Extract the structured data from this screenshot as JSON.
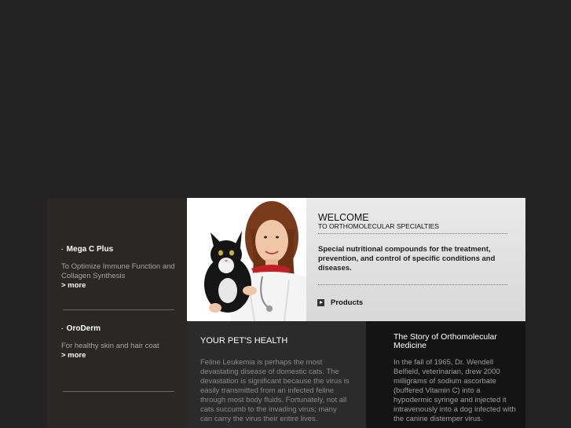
{
  "sidebar": {
    "items": [
      {
        "title": "Mega C Plus",
        "description": "To Optimize Immune Function and Collagen Synthesis",
        "more": "> more"
      },
      {
        "title": "OroDerm",
        "description": "For healthy skin and hair coat",
        "more": "> more"
      }
    ]
  },
  "hero": {
    "welcome": "WELCOME",
    "subtitle": "TO ORTHOMOLECULAR SPECIALTIES",
    "description": "Special nutritional compounds for the treatment, prevention, and control of specific conditions and diseases.",
    "products_label": "Products"
  },
  "health": {
    "title": "YOUR PET'S HEALTH",
    "text": "Feline Leukemia is perhaps the most devastating disease of domestic cats. The devastation is significant because the virus is easily transmitted from an infected feline through most body fluids. Fortunately, not all cats succumb to the invading virus; many can carry the virus their entire lives."
  },
  "story": {
    "title": "The Story of Orthomolecular Medicine",
    "text": "In the fall of 1965, Dr. Wendell Belfield, veterinarian, drew 2000 milligrams of sodium ascorbate (buffered Vitamin C) into a hypodermic syringe and injected it intravenously into a dog infected with the canine distemper virus."
  },
  "colors": {
    "page_bg": "#232323",
    "sidebar_bg": "#2c2727",
    "hero_bg": "#dcdcdc",
    "story_bg": "#141414"
  }
}
